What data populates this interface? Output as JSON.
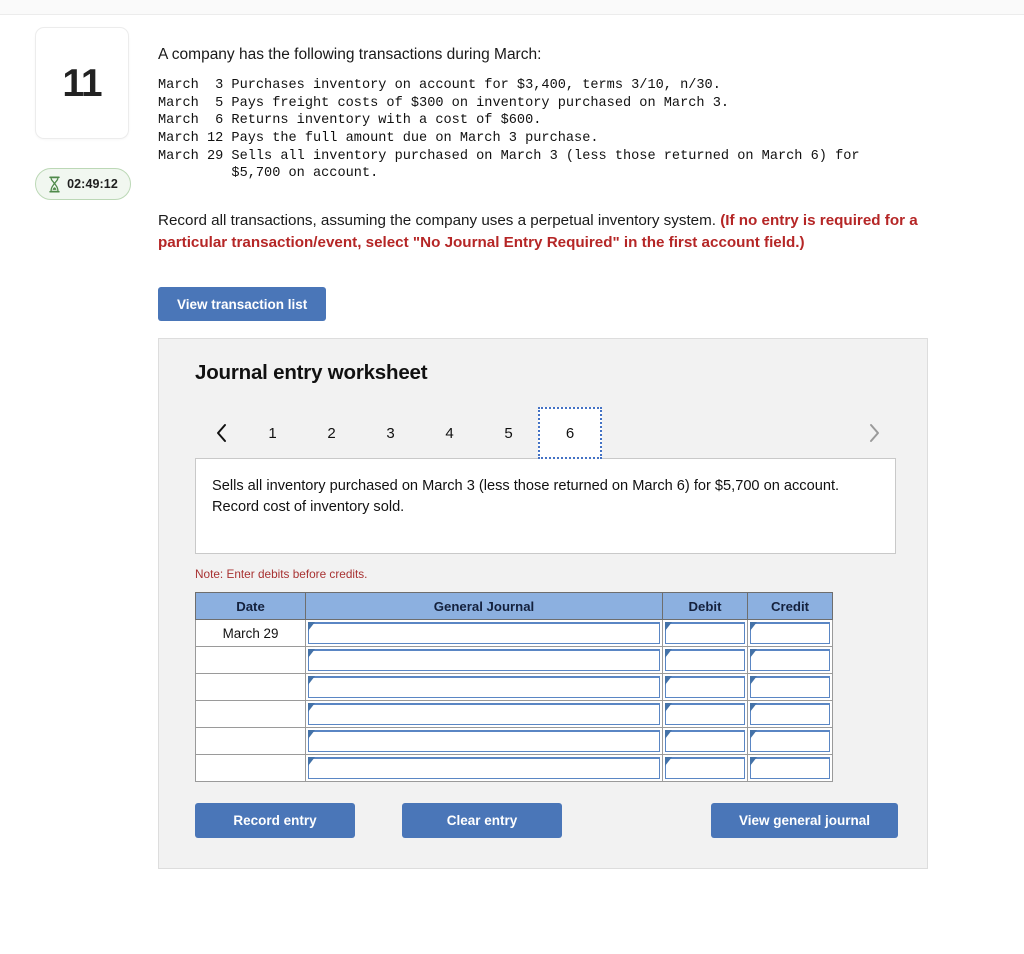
{
  "question": {
    "number": "11",
    "timer": "02:49:12",
    "timer_icon": "hourglass-icon"
  },
  "prompt": {
    "intro": "A company has the following transactions during March:",
    "transactions_text": "March  3 Purchases inventory on account for $3,400, terms 3/10, n/30.\nMarch  5 Pays freight costs of $300 on inventory purchased on March 3.\nMarch  6 Returns inventory with a cost of $600.\nMarch 12 Pays the full amount due on March 3 purchase.\nMarch 29 Sells all inventory purchased on March 3 (less those returned on March 6) for\n         $5,700 on account.",
    "instruction_plain": "Record all transactions, assuming the company uses a perpetual inventory system. ",
    "instruction_warning": "(If no entry is required for a particular transaction/event, select \"No Journal Entry Required\" in the first account field.)",
    "view_transaction_list_label": "View transaction list"
  },
  "worksheet": {
    "title": "Journal entry worksheet",
    "pager": {
      "prev_icon": "chevron-left-icon",
      "next_icon": "chevron-right-icon",
      "pages": [
        "1",
        "2",
        "3",
        "4",
        "5",
        "6"
      ],
      "active_page": "6"
    },
    "description": "Sells all inventory purchased on March 3 (less those returned on March 6) for $5,700 on account. Record cost of inventory sold.",
    "note": "Note: Enter debits before credits.",
    "table": {
      "headers": [
        "Date",
        "General Journal",
        "Debit",
        "Credit"
      ],
      "rows": [
        {
          "date": "March 29",
          "general_journal": "",
          "debit": "",
          "credit": ""
        },
        {
          "date": "",
          "general_journal": "",
          "debit": "",
          "credit": ""
        },
        {
          "date": "",
          "general_journal": "",
          "debit": "",
          "credit": ""
        },
        {
          "date": "",
          "general_journal": "",
          "debit": "",
          "credit": ""
        },
        {
          "date": "",
          "general_journal": "",
          "debit": "",
          "credit": ""
        },
        {
          "date": "",
          "general_journal": "",
          "debit": "",
          "credit": ""
        }
      ]
    },
    "actions": {
      "record_label": "Record entry",
      "clear_label": "Clear entry",
      "journal_label": "View general journal"
    }
  },
  "colors": {
    "button_blue": "#4a76b8",
    "table_header_blue": "#8cb0e0",
    "field_blue": "#5a86c4",
    "warning_red": "#b52626",
    "note_red": "#a83232",
    "timer_green": "#4f8a4a",
    "panel_gray": "#f2f2f2"
  }
}
